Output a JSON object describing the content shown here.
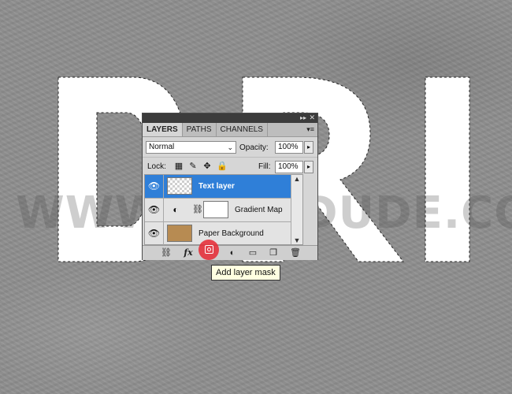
{
  "watermark": "WWW.PSD-DUDE.COM",
  "canvas_letters": [
    "D",
    "R",
    "I"
  ],
  "panel": {
    "tabs": [
      {
        "label": "LAYERS",
        "active": true
      },
      {
        "label": "PATHS",
        "active": false
      },
      {
        "label": "CHANNELS",
        "active": false
      }
    ],
    "blend_mode": "Normal",
    "opacity_label": "Opacity:",
    "opacity_value": "100%",
    "lock_label": "Lock:",
    "fill_label": "Fill:",
    "fill_value": "100%",
    "layers": [
      {
        "name": "Text layer",
        "selected": true,
        "thumb": "transparent-checker"
      },
      {
        "name": "Gradient Map",
        "selected": false,
        "thumb": "white-mask",
        "icon": "adjustment-icon"
      },
      {
        "name": "Paper Background",
        "selected": false,
        "thumb": "paper"
      }
    ],
    "bottom_icons": [
      "link-icon",
      "fx-icon",
      "add-mask-icon",
      "adjustment-icon",
      "folder-icon",
      "new-layer-icon",
      "trash-icon"
    ]
  },
  "tooltip": "Add layer mask",
  "colors": {
    "selected_layer": "#2f7fd8",
    "highlight": "#e62832",
    "tooltip_bg": "#ffffe1"
  }
}
